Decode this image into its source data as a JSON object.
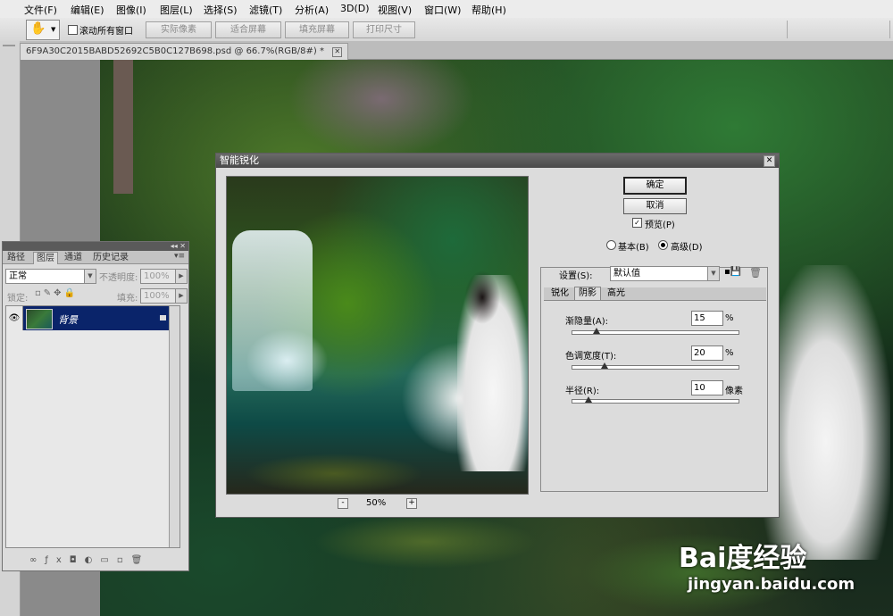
{
  "menubar": {
    "items": [
      "文件(F)",
      "编辑(E)",
      "图像(I)",
      "图层(L)",
      "选择(S)",
      "滤镜(T)",
      "分析(A)",
      "3D(D)",
      "视图(V)",
      "窗口(W)",
      "帮助(H)"
    ]
  },
  "options": {
    "scroll_all_label": "滚动所有窗口",
    "buttons": [
      "实际像素",
      "适合屏幕",
      "填充屏幕",
      "打印尺寸"
    ]
  },
  "document": {
    "tab_title": "6F9A30C2015BABD52692C5B0C127B698.psd @ 66.7%(RGB/8#) *"
  },
  "layers_panel": {
    "tabs": [
      "路径",
      "图层",
      "通道",
      "历史记录"
    ],
    "blend_mode": "正常",
    "opacity_label": "不透明度:",
    "opacity_value": "100%",
    "lock_label": "锁定:",
    "fill_label": "填充:",
    "fill_value": "100%",
    "layer_name": "背景"
  },
  "dialog": {
    "title": "智能锐化",
    "ok": "确定",
    "cancel": "取消",
    "preview_label": "预览(P)",
    "basic_label": "基本(B)",
    "advanced_label": "高级(D)",
    "settings_label": "设置(S):",
    "settings_value": "默认值",
    "tabs": [
      "锐化",
      "阴影",
      "高光"
    ],
    "fields": [
      {
        "label": "渐隐量(A):",
        "value": "15",
        "unit": "%",
        "level": 0.15
      },
      {
        "label": "色调宽度(T):",
        "value": "20",
        "unit": "%",
        "level": 0.2
      },
      {
        "label": "半径(R):",
        "value": "10",
        "unit": "像素",
        "level": 0.1
      }
    ],
    "zoom_minus": "-",
    "zoom_value": "50%",
    "zoom_plus": "+"
  },
  "watermark": {
    "brand": "Bai度经验",
    "url": "jingyan.baidu.com"
  }
}
